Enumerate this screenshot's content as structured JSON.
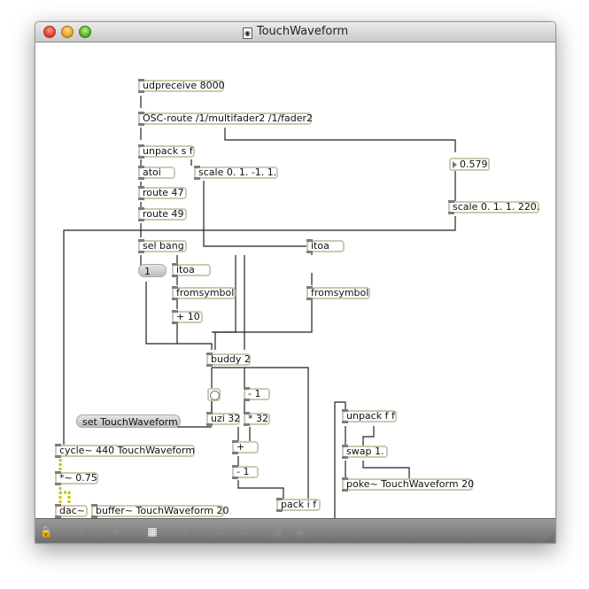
{
  "window": {
    "title": "TouchWaveform"
  },
  "patch": {
    "udpreceive": "udpreceive 8000",
    "osc_route": "OSC-route /1/multifader2 /1/fader2",
    "unpack_sf": "unpack s f",
    "atoi": "atoi",
    "scale_top": "scale 0. 1. -1. 1.",
    "route47": "route 47",
    "route49": "route 49",
    "number_value": "0.579",
    "scale_right": "scale 0. 1. 1. 220.",
    "sel_bang": "sel bang",
    "itoa_right": "itoa",
    "msg_one": "1",
    "itoa_left": "itoa",
    "fromsymbol_left": "fromsymbol",
    "fromsymbol_right": "fromsymbol",
    "plus10": "+ 10",
    "buddy": "buddy 2",
    "minus1_top": "- 1",
    "msg_set": "set TouchWaveform",
    "uzi": "uzi 32",
    "times32": "* 32",
    "unpack_ff": "unpack f f",
    "cycle": "cycle~ 440 TouchWaveform",
    "plus": "+",
    "swap": "swap 1.",
    "times075": "*~ 0.75",
    "minus1_bottom": "- 1",
    "poke": "poke~ TouchWaveform 20",
    "pack": "pack i f",
    "dac": "dac~",
    "buffer": "buffer~ TouchWaveform 20"
  },
  "toolbar": {
    "lock": "lock-icon",
    "add": "plus-icon",
    "move": "move-arrows-icon",
    "presentation": "presentation-icon",
    "inspector": "info-icon",
    "grid": "grid-icon",
    "snap": "snap-icon"
  }
}
